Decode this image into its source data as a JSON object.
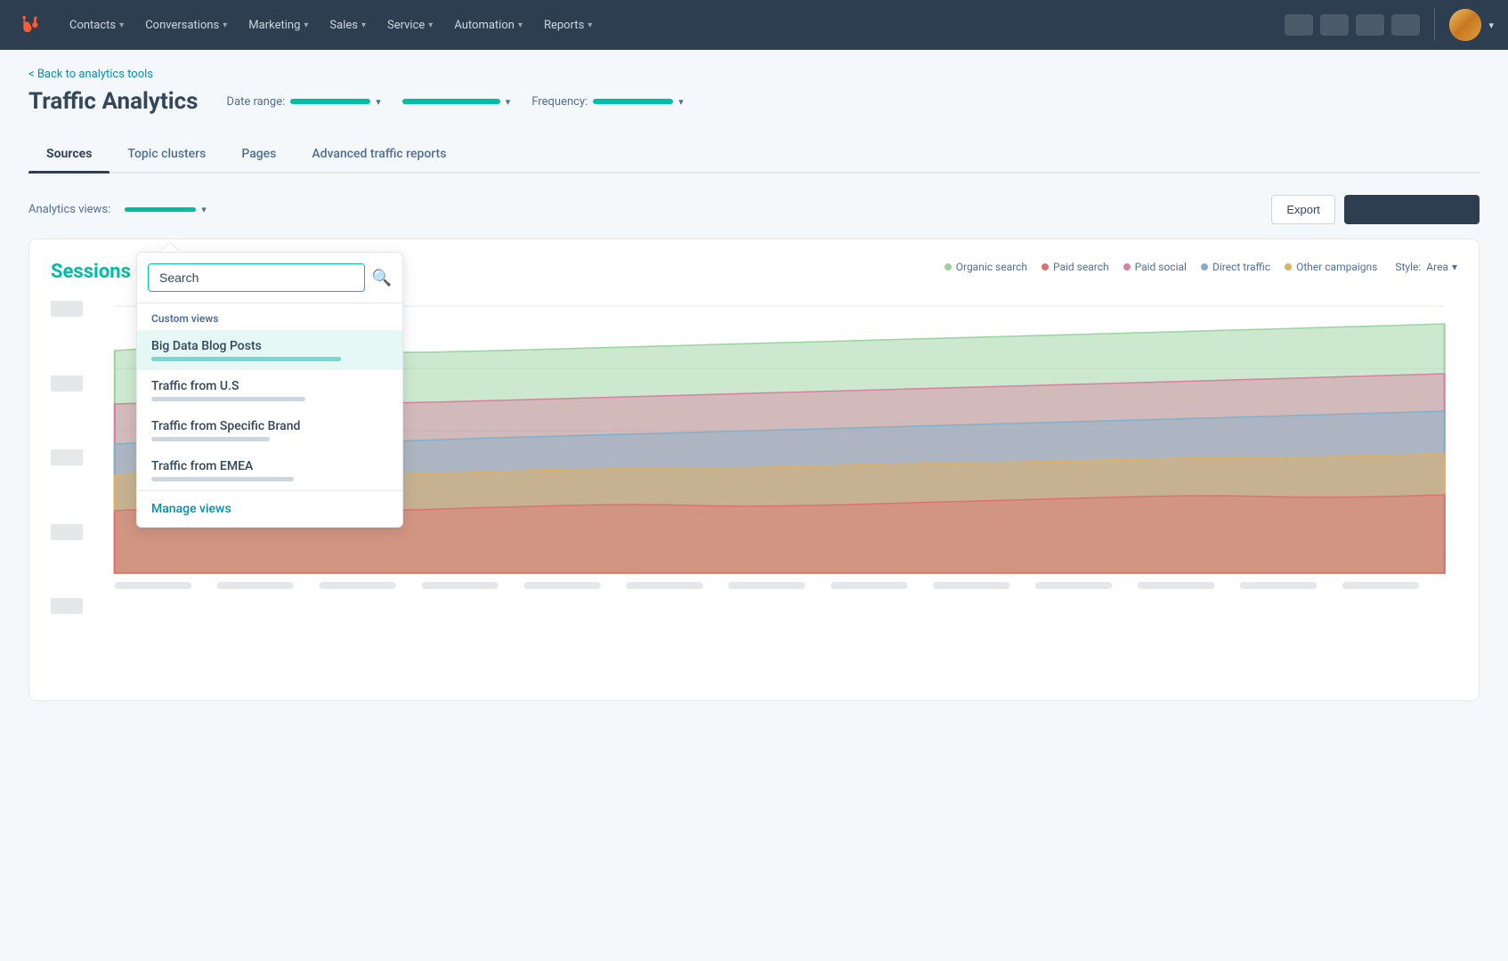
{
  "nav": {
    "logo_color": "#ff5c35",
    "items": [
      {
        "label": "Contacts",
        "id": "contacts"
      },
      {
        "label": "Conversations",
        "id": "conversations"
      },
      {
        "label": "Marketing",
        "id": "marketing"
      },
      {
        "label": "Sales",
        "id": "sales"
      },
      {
        "label": "Service",
        "id": "service"
      },
      {
        "label": "Automation",
        "id": "automation"
      },
      {
        "label": "Reports",
        "id": "reports"
      }
    ]
  },
  "page": {
    "back_label": "< Back to analytics tools",
    "title": "Traffic Analytics",
    "date_range_label": "Date range:",
    "frequency_label": "Frequency:"
  },
  "tabs": [
    {
      "label": "Sources",
      "id": "sources",
      "active": true
    },
    {
      "label": "Topic clusters",
      "id": "topic-clusters",
      "active": false
    },
    {
      "label": "Pages",
      "id": "pages",
      "active": false
    },
    {
      "label": "Advanced traffic reports",
      "id": "advanced",
      "active": false
    }
  ],
  "analytics_views": {
    "label": "Analytics views:",
    "value_bar_width": "80px"
  },
  "toolbar": {
    "export_label": "Export",
    "primary_label": "────────────"
  },
  "chart": {
    "metric_label": "Sessions",
    "style_label": "Style:",
    "style_value": "Area",
    "legend": [
      {
        "label": "Organic search",
        "color": "#99d4a0"
      },
      {
        "label": "Paid search",
        "color": "#e07070"
      },
      {
        "label": "Paid social",
        "color": "#d980a0"
      },
      {
        "label": "Direct traffic",
        "color": "#80b0cc"
      },
      {
        "label": "Other campaigns",
        "color": "#e0b060"
      }
    ]
  },
  "dropdown": {
    "search_placeholder": "Search",
    "custom_views_label": "Custom views",
    "items": [
      {
        "name": "Big Data Blog Posts",
        "bar_width": "80%",
        "selected": true
      },
      {
        "name": "Traffic from U.S",
        "bar_width": "65%",
        "selected": false
      },
      {
        "name": "Traffic from Specific Brand",
        "bar_width": "50%",
        "selected": false
      },
      {
        "name": "Traffic from EMEA",
        "bar_width": "60%",
        "selected": false
      }
    ],
    "manage_label": "Manage views"
  }
}
